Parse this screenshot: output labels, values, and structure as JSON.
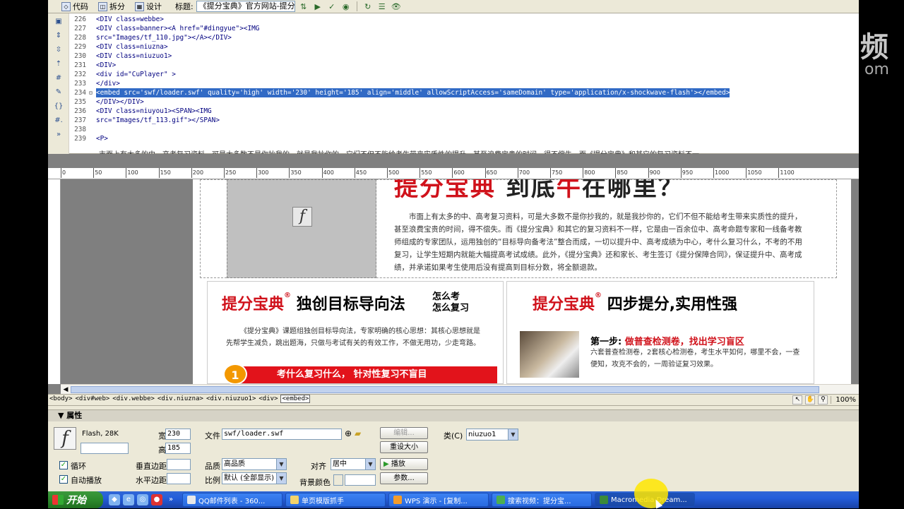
{
  "toolbar": {
    "code_label": "代码",
    "split_label": "拆分",
    "design_label": "设计",
    "title_label": "标题:",
    "title_value": "《提分宝典》官方网站-提分"
  },
  "code": {
    "lines": [
      {
        "num": "226",
        "text": "<DIV class=webbe>"
      },
      {
        "num": "227",
        "text": "<DIV class=banner><A href=\"#dingyue\"><IMG"
      },
      {
        "num": "228",
        "text": "src=\"Images/tf_110.jpg\"></A></DIV>"
      },
      {
        "num": "229",
        "text": "<DIV class=niuzna>"
      },
      {
        "num": "230",
        "text": "<DIV class=niuzuo1>"
      },
      {
        "num": "231",
        "text": "<DIV>"
      },
      {
        "num": "232",
        "text": "<div id=\"CuPlayer\" >"
      },
      {
        "num": "233",
        "text": "</div>"
      },
      {
        "num": "234",
        "text": "<embed src='swf/loader.swf' quality='high' width='230' height='185' align='middle' allowScriptAccess='sameDomain' type='application/x-shockwave-flash'></embed>"
      },
      {
        "num": "235",
        "text": "</DIV></DIV>"
      },
      {
        "num": "236",
        "text": "<DIV class=niuyou1><SPAN><IMG"
      },
      {
        "num": "237",
        "text": "src=\"Images/tf_113.gif\"></SPAN>"
      },
      {
        "num": "238",
        "text": ""
      },
      {
        "num": "239",
        "text": "<P>"
      }
    ],
    "truncated_line": "市面上有太多的中、高考复习资料，可是大多数不是你抄我的，就是我抄你的，它们不但不能给考生带来实质性的提升，甚至浪费宝贵的时间，得不偿失。而《提分宝典》和其它的复习资料不一"
  },
  "ruler": {
    "ticks": [
      "0",
      "50",
      "100",
      "150",
      "200",
      "250",
      "300",
      "350",
      "400",
      "450",
      "500",
      "550",
      "600",
      "650",
      "700",
      "750",
      "800",
      "850",
      "900",
      "950",
      "1000",
      "1050",
      "1100"
    ]
  },
  "page": {
    "headline_black1": "提分宝典",
    "headline_mid": "到底",
    "headline_red": "牛",
    "headline_end": "在哪里？",
    "intro": "市面上有太多的中、高考复习资料，可是大多数不是你抄我的，就是我抄你的，它们不但不能给考生带来实质性的提升，甚至浪费宝贵的时间，得不偿失。而《提分宝典》和其它的复习资料不一样，它是由一百余位中、高考命题专家和一线备考教师组成的专家团队，运用独创的“目标导向备考法”整合而成，一切以提升中、高考成绩为中心，考什么复习什么，不考的不用复习，让学生短期内就能大幅提高考试成绩。此外，《提分宝典》还和家长、考生签订《提分保障合同》，保证提升中、高考成绩，并承诺如果考生使用后没有提高到目标分数，将全额退款。",
    "left_title_red": "提分宝典",
    "left_title_rest": "独创目标导向法",
    "left_small1": "怎么考",
    "left_small2": "怎么复习",
    "left_para": "《提分宝典》课题组独创目标导向法，专家明确的核心思想：其核心思想就是先帮学生减负，跳出题海，只做与考试有关的有效工作，不做无用功，少走弯路。",
    "left_num": "1",
    "left_bar": "考什么复习什么， 针对性复习不盲目",
    "right_title_red": "提分宝典",
    "right_title_rest": "四步提分,实用性强",
    "step_label": "第一步:",
    "step_red": "做普查检测卷，找出学习盲区",
    "step_para": "六套普查检测卷，2套核心检测卷，考生水平如何，哪里不会，一查便知，攻克不会的，一周验证复习效果。",
    "reg_mark": "®"
  },
  "statusbar": {
    "tags": [
      "<body>",
      "<div#web>",
      "<div.webbe>",
      "<div.niuzna>",
      "<div.niuzuo1>",
      "<div>",
      "<embed>"
    ],
    "zoom": "100%"
  },
  "props": {
    "header": "属性",
    "type_label": "Flash, 28K",
    "name_value": "",
    "width_label": "宽",
    "width_value": "230",
    "height_label": "高",
    "height_value": "185",
    "file_label": "文件",
    "file_value": "swf/loader.swf",
    "edit_label": "编辑...",
    "reset_label": "重设大小",
    "class_label": "类(C)",
    "class_value": "niuzuo1",
    "loop_label": "循环",
    "autoplay_label": "自动播放",
    "vspace_label": "垂直边距",
    "hspace_label": "水平边距",
    "quality_label": "品质",
    "quality_value": "高品质",
    "scale_label": "比例",
    "scale_value": "默认 (全部显示)",
    "align_label": "对齐",
    "align_value": "居中",
    "bgcolor_label": "背景颜色",
    "play_label": "播放",
    "params_label": "参数..."
  },
  "taskbar": {
    "start_label": "开始",
    "tasks": [
      {
        "label": "QQ邮件列表 - 360..."
      },
      {
        "label": "单页模版抓手"
      },
      {
        "label": "WPS 演示 - [复制..."
      },
      {
        "label": "搜索视频：提分宝..."
      },
      {
        "label": "Macromedia Dream..."
      }
    ]
  },
  "watermark": {
    "line1": "频",
    "line2": "om"
  }
}
